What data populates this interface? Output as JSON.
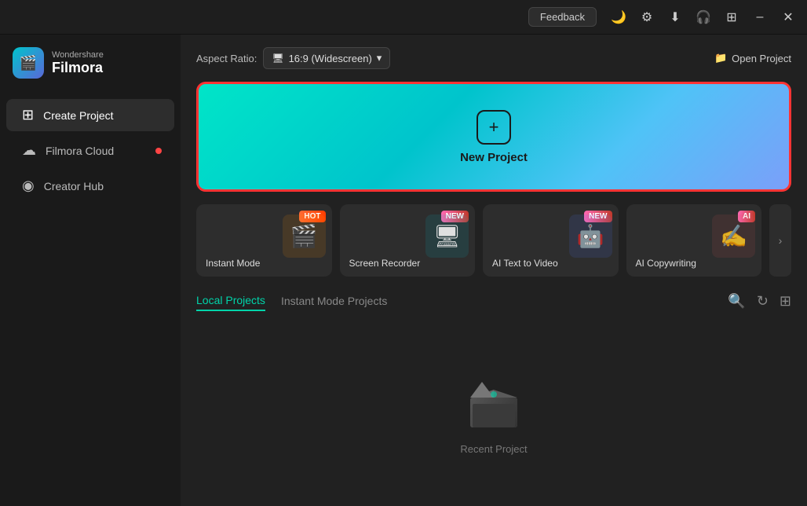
{
  "titlebar": {
    "feedback_label": "Feedback",
    "minimize_label": "–",
    "close_label": "✕"
  },
  "sidebar": {
    "logo": {
      "top": "Wondershare",
      "bottom": "Filmora"
    },
    "items": [
      {
        "id": "create-project",
        "label": "Create Project",
        "icon": "⊞",
        "active": true,
        "dot": false
      },
      {
        "id": "filmora-cloud",
        "label": "Filmora Cloud",
        "icon": "☁",
        "active": false,
        "dot": true
      },
      {
        "id": "creator-hub",
        "label": "Creator Hub",
        "icon": "◉",
        "active": false,
        "dot": false
      }
    ]
  },
  "topbar": {
    "aspect_ratio_label": "Aspect Ratio:",
    "aspect_ratio_value": "16:9 (Widescreen)",
    "open_project_label": "Open Project"
  },
  "new_project": {
    "label": "New Project",
    "icon": "+"
  },
  "feature_cards": [
    {
      "id": "instant-mode",
      "label": "Instant Mode",
      "badge": "HOT",
      "badge_type": "hot",
      "emoji": "🎬"
    },
    {
      "id": "screen-recorder",
      "label": "Screen Recorder",
      "badge": "NEW",
      "badge_type": "new",
      "emoji": "🖥"
    },
    {
      "id": "ai-text-to-video",
      "label": "AI Text to Video",
      "badge": "NEW",
      "badge_type": "new",
      "emoji": "🤖"
    },
    {
      "id": "ai-copywriting",
      "label": "AI Copywriting",
      "badge": "AI",
      "badge_type": "new",
      "emoji": "✍"
    }
  ],
  "chevron": "›",
  "project_tabs": [
    {
      "id": "local-projects",
      "label": "Local Projects",
      "active": true
    },
    {
      "id": "instant-mode-projects",
      "label": "Instant Mode Projects",
      "active": false
    }
  ],
  "tab_actions": {
    "search_icon": "🔍",
    "refresh_icon": "↻",
    "grid_icon": "⊞"
  },
  "empty_state": {
    "label": "Recent Project"
  },
  "colors": {
    "accent": "#00d4aa",
    "hot_badge": "#ff3d00",
    "new_badge": "#e91e8c",
    "sidebar_bg": "#1a1a1a",
    "content_bg": "#212121"
  }
}
